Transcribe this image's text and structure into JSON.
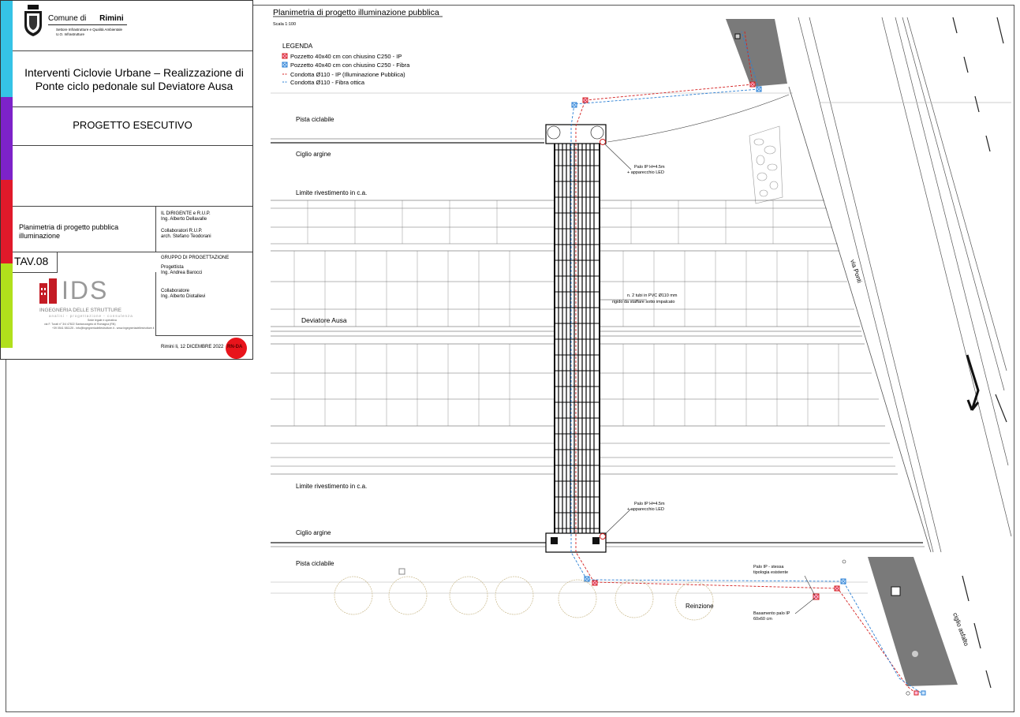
{
  "title_block": {
    "comune_prefix": "Comune di",
    "comune_name": "Rimini",
    "settore": "Settore Infrastrutture e Qualità Ambientale",
    "unita": "U.O. Infrastrutture",
    "project_title": "Interventi Ciclovie Urbane – Realizzazione di Ponte ciclo pedonale sul Deviatore Ausa",
    "phase": "PROGETTO ESECUTIVO",
    "drawing_title": "Planimetria di progetto pubblica illuminazione",
    "tav": "TAV.08",
    "dirigente_label": "IL DIRIGENTE e R.U.P.",
    "dirigente_name": "Ing. Alberto Dellavalle",
    "collab_rup_label": "Collaboratori R.U.P.",
    "collab_rup_name": "arch. Stefano Teodorani",
    "gruppo_label": "GRUPPO DI PROGETTAZIONE",
    "progettista_label": "Progettista",
    "progettista_name": "Ing. Andrea Barocci",
    "collaboratore_label": "Collaboratore",
    "collaboratore_name": "Ing. Alberto Diotallevi",
    "ids_logo": "IDS",
    "ids_sub": "INGEGNERIA DELLE STRUTTURE",
    "ids_tag": "analisi - progettazione - consulenza",
    "ids_addr1": "Sede legale e operativa",
    "ids_addr2": "via F. Turati n° 3/4 47822 Santarcangelo di Romagna (RN)",
    "ids_addr3": "+39 0541 581125 - info@ingegneriadellestrutture.it - www.ingegneriadellestrutture.it",
    "date": "Rimini li, 12 DICEMBRE 2022",
    "stamp": "RN-DA",
    "color_bar": [
      "#35c3e6",
      "#7d22c9",
      "#e0192a",
      "#b1e01c"
    ]
  },
  "plan": {
    "title": "Planimetria di progetto illuminazione pubblica",
    "scale": "Scala 1:100",
    "legend_title": "LEGENDA",
    "legend": [
      {
        "symbol": "pozzetto-ip",
        "label": "Pozzetto 40x40 cm con chiusino C250 - IP",
        "color": "#d42020"
      },
      {
        "symbol": "pozzetto-fibra",
        "label": "Pozzetto 40x40 cm con chiusino C250 - Fibra",
        "color": "#2a7fd4"
      },
      {
        "symbol": "condotta-ip",
        "label": "Condotta Ø110 - IP (Illuminazione Pubblica)",
        "color": "#d42020"
      },
      {
        "symbol": "condotta-fibra",
        "label": "Condotta Ø110 - Fibra ottica",
        "color": "#2a7fd4"
      }
    ],
    "labels": {
      "pista_top": "Pista ciclabile",
      "ciglio_top": "Ciglio argine",
      "limite_top": "Limite rivestimento in c.a.",
      "deviatore": "Deviatore Ausa",
      "limite_bottom": "Limite rivestimento in c.a.",
      "ciglio_bottom": "Ciglio argine",
      "pista_bottom": "Pista ciclabile",
      "palo_top_1": "Palo IP H=4.5m",
      "palo_top_2": "+ apparecchio LED",
      "palo_bottom_1": "Palo IP H=4.5m",
      "palo_bottom_2": "+ apparecchio LED",
      "tubi_1": "n. 2 tubi in PVC Ø110 mm",
      "tubi_2": "rigido da staffare sotto impalcato",
      "via": "via Ponti",
      "reinzione": "Reinzione",
      "palo_esist_1": "Palo IP - stessa",
      "palo_esist_2": "tipologia esistente",
      "basamento_1": "Basamento palo IP",
      "basamento_2": "60x60 cm",
      "ciglio_asfalto": "ciglio asfalto"
    }
  }
}
